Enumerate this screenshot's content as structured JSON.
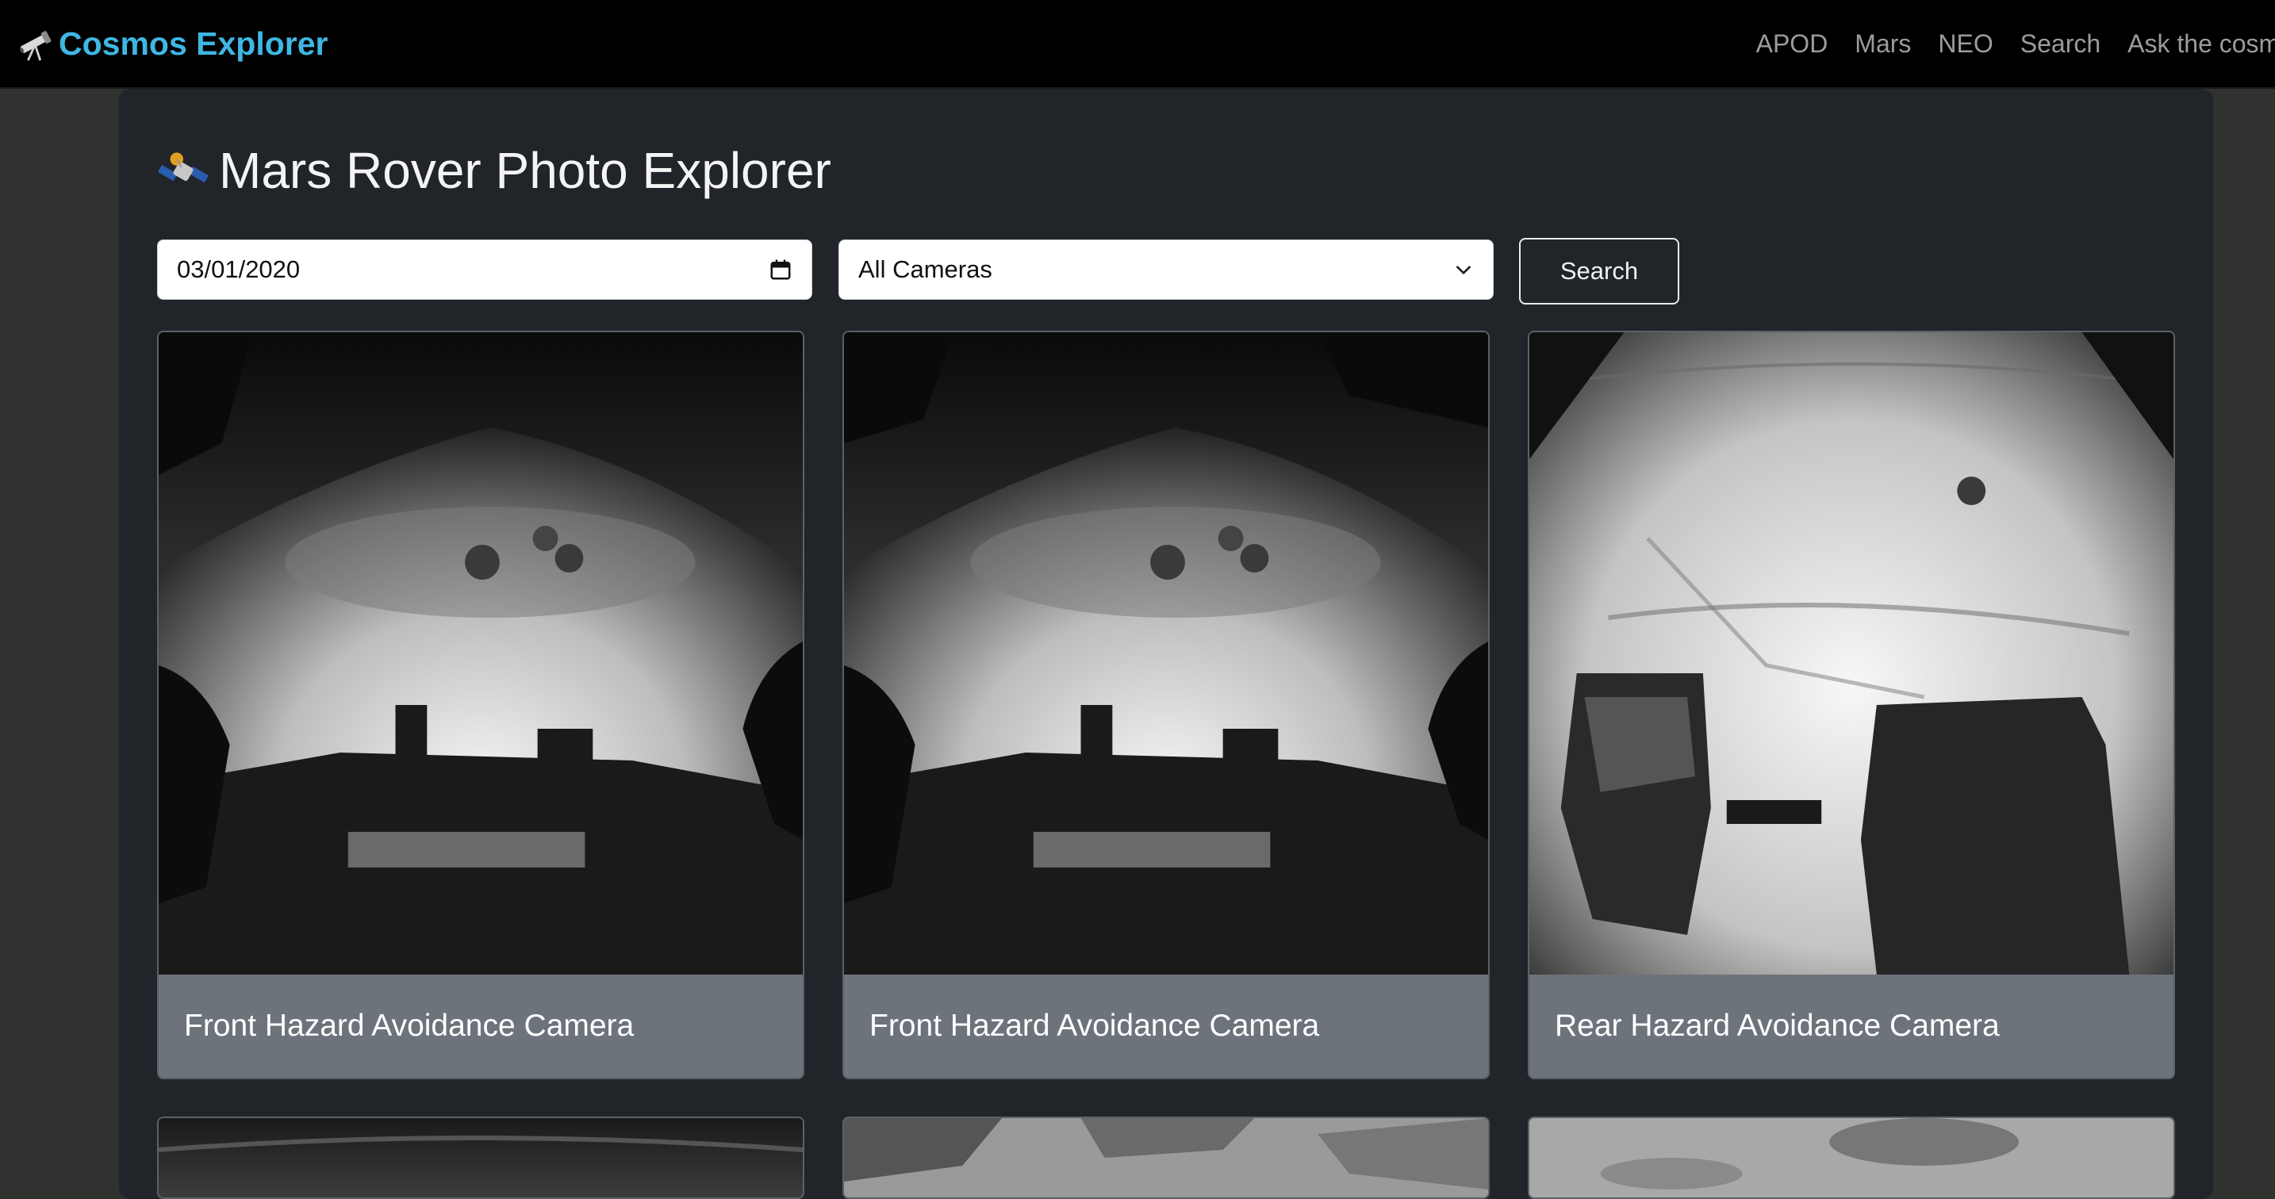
{
  "navbar": {
    "brand": "Cosmos Explorer",
    "brand_icon": "telescope-icon",
    "links": [
      "APOD",
      "Mars",
      "NEO",
      "Search",
      "Ask the cosmos"
    ]
  },
  "page": {
    "title": "Mars Rover Photo Explorer",
    "title_icon": "satellite-icon"
  },
  "filters": {
    "date_value": "03/01/2020",
    "camera_selected": "All Cameras",
    "search_label": "Search"
  },
  "photos": [
    {
      "camera": "Front Hazard Avoidance Camera",
      "image": "front-hazcam-photo-a"
    },
    {
      "camera": "Front Hazard Avoidance Camera",
      "image": "front-hazcam-photo-b"
    },
    {
      "camera": "Rear Hazard Avoidance Camera",
      "image": "rear-hazcam-photo"
    }
  ],
  "colors": {
    "brand": "#3fb7e3",
    "navbar_bg": "#000000",
    "page_bg": "#2f322e",
    "container_bg": "#212529",
    "card_caption_bg": "#6c737b"
  }
}
